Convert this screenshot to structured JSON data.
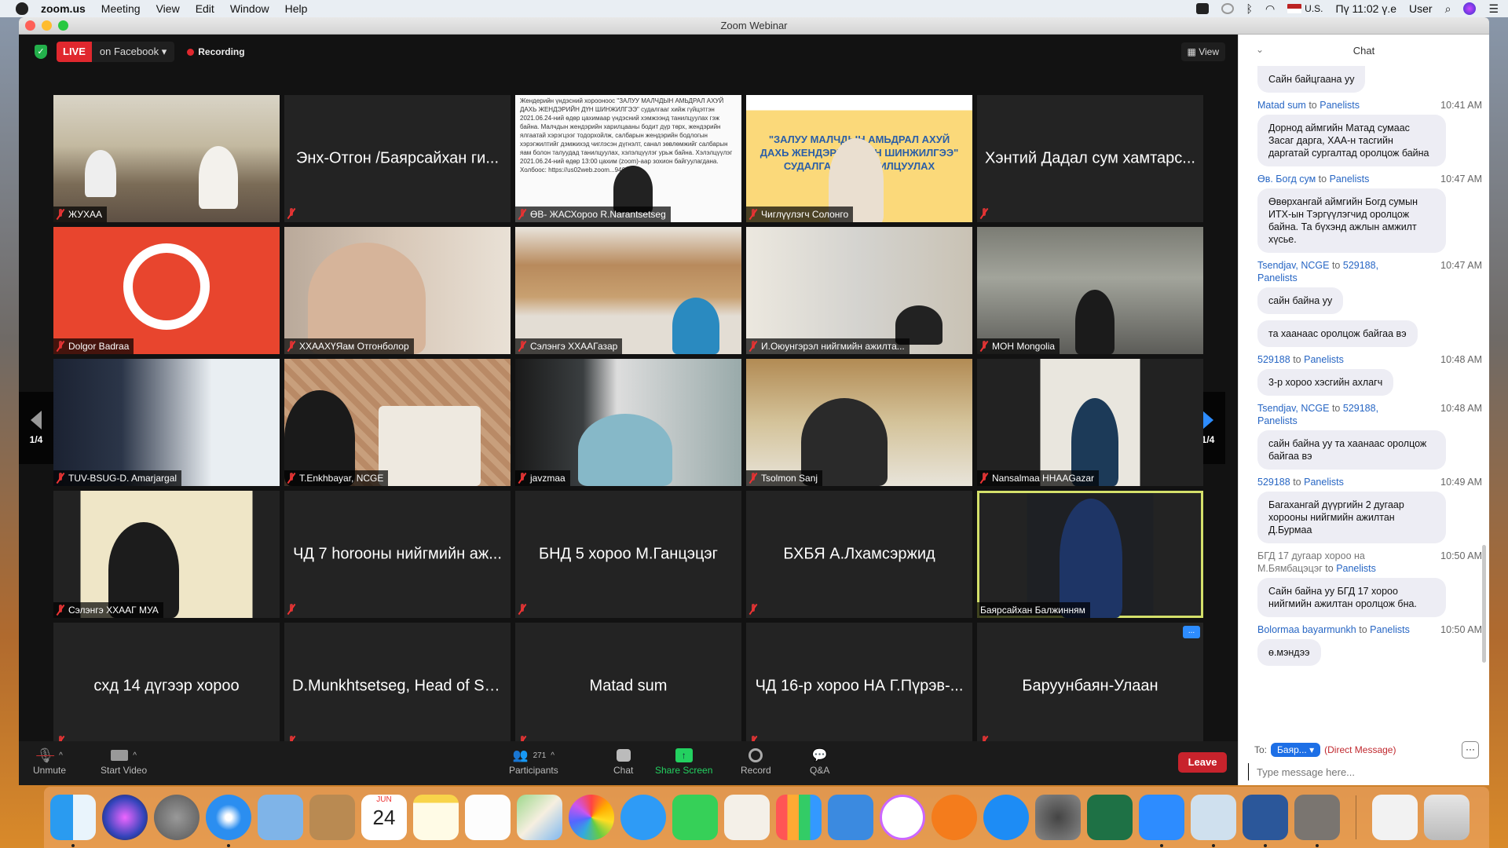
{
  "menubar": {
    "app": "zoom.us",
    "items": [
      "Meeting",
      "View",
      "Edit",
      "Window",
      "Help"
    ],
    "input_source": "U.S.",
    "clock": "Пү 11:02 ү.е",
    "user": "User"
  },
  "window": {
    "title": "Zoom Webinar"
  },
  "topbar": {
    "live_label": "LIVE",
    "live_target": "on Facebook",
    "recording_label": "Recording",
    "view_label": "View"
  },
  "pager": {
    "left_label": "1/4",
    "right_label": "1/4"
  },
  "tiles": [
    {
      "name": "ЖУХАА",
      "video": true,
      "muted": true
    },
    {
      "name": "Энх-Отгон /Баярсайхан ги...",
      "video": false,
      "muted": true
    },
    {
      "name": "ӨВ- ЖАСХороо R.Narantsetseg",
      "video": true,
      "muted": true,
      "shared_text": "Жендерийн үндэсний хорооноос \"ЗАЛУУ МАЛЧДЫН АМЬДРАЛ АХУЙ ДАХЬ ЖЕНДЭРИЙН ДҮН ШИНЖИЛГЭЭ\" судалгааг хийж гүйцэтгэн 2021.06.24-ний өдөр цахимаар үндэсний хэмжээнд танилцуулах гэж байна. Малчдын жендэрийн харилцааны бодит дүр төрх, жендэрийн ялгаатай хэрэгцээг тодорхойлж, салбарын жендэрийн бодлогын хэрэгжилтийг дэмжихэд чиглэсэн дүгнэлт, санал зөвлөмжийг салбарын яам болон талуудад танилцуулах, хэлэлцүүлэг урьж байна. Хэлэлцүүлэг 2021.06.24-ний өдөр 13:00 цахим (zoom)-аар зохион байгуулагдана. Холбоос: https://us02web.zoom...94662..."
    },
    {
      "name": "Чиглүүлэгч Солонго",
      "video": true,
      "muted": true,
      "shared_title": "\"ЗАЛУУ МАЛЧДЫН АМЬДРАЛ АХУЙ ДАХЬ ЖЕНДЭРИЙН ДҮН ШИНЖИЛГЭЭ\" СУДАЛГААНЫ ТАНИЛЦУУЛАХ"
    },
    {
      "name": "Хэнтий Дадал сум хамтарс...",
      "video": false,
      "muted": true
    },
    {
      "name": "Dolgor Badraa",
      "video": true,
      "muted": true
    },
    {
      "name": "ХХААХҮЯам Отгонболор",
      "video": true,
      "muted": true
    },
    {
      "name": "Сэлэнгэ ХХААГазар",
      "video": true,
      "muted": true
    },
    {
      "name": "И.Оюунгэрэл нийгмийн ажилта...",
      "video": true,
      "muted": true
    },
    {
      "name": "МОН Mongolia",
      "video": true,
      "muted": true
    },
    {
      "name": "TUV-BSUG-D. Amarjargal",
      "video": true,
      "muted": true
    },
    {
      "name": "T.Enkhbayar, NCGE",
      "video": true,
      "muted": true
    },
    {
      "name": "javzmaa",
      "video": true,
      "muted": true
    },
    {
      "name": "Tsolmon Sanj",
      "video": true,
      "muted": true
    },
    {
      "name": "Nansalmaa HHAAGazar",
      "video": true,
      "muted": true
    },
    {
      "name": "Сэлэнгэ ХХААГ МУА",
      "video": true,
      "muted": true
    },
    {
      "name": "ЧД 7 horooны нийгмийн аж...",
      "video": false,
      "muted": true
    },
    {
      "name": "БНД 5 хороо М.Ганцэцэг",
      "video": false,
      "muted": true
    },
    {
      "name": "БХБЯ А.Лхамсэржид",
      "video": false,
      "muted": true
    },
    {
      "name": "Баярсайхан Балжинням",
      "video": true,
      "muted": false,
      "active_speaker": true
    },
    {
      "name": "схд 14 дүгээр хороо",
      "video": false,
      "muted": true
    },
    {
      "name": "D.Munkhtsetseg, Head of So...",
      "video": false,
      "muted": true
    },
    {
      "name": "Matad sum",
      "video": false,
      "muted": true
    },
    {
      "name": "ЧД 16-р хороо НА Г.Пүрэв-...",
      "video": false,
      "muted": true
    },
    {
      "name": "Баруунбаян-Улаан",
      "video": false,
      "muted": true,
      "more_icon": "..."
    }
  ],
  "toolbar": {
    "unmute": "Unmute",
    "start_video": "Start Video",
    "participants": "Participants",
    "participant_count": "271",
    "chat": "Chat",
    "share_screen": "Share Screen",
    "record": "Record",
    "qa": "Q&A",
    "leave": "Leave"
  },
  "chat": {
    "title": "Chat",
    "messages": [
      {
        "sender": "",
        "to": "",
        "time": "",
        "text": "Сайн байцгаана уу"
      },
      {
        "sender": "Matad sum",
        "to": "Panelists",
        "time": "10:41 AM",
        "text": "Дорнод аймгийн Матад сумаас Засаг дарга, ХАА-н тасгийн даргатай сургалтад оролцож байна"
      },
      {
        "sender": "Өв. Богд сум",
        "to": "Panelists",
        "time": "10:47 AM",
        "text": "Өвөрхангай аймгийн Богд сумын ИТХ-ын Тэргүүлэгчид оролцож байна. Та бүхэнд ажлын амжилт хүсье."
      },
      {
        "sender": "Tsendjav, NCGE",
        "to": "529188, Panelists",
        "time": "10:47 AM",
        "text": "сайн байна уу"
      },
      {
        "sender": "",
        "to": "",
        "time": "",
        "text": "та хаанаас оролцож байгаа вэ"
      },
      {
        "sender": "529188",
        "to": "Panelists",
        "time": "10:48 AM",
        "text": "3-р хороо хэсгийн ахлагч"
      },
      {
        "sender": "Tsendjav, NCGE",
        "to": "529188, Panelists",
        "time": "10:48 AM",
        "text": "сайн байна уу та хаанаас оролцож байгаа вэ"
      },
      {
        "sender": "529188",
        "to": "Panelists",
        "time": "10:49 AM",
        "text": "Багахангай дүүргийн 2 дугаар хорооны нийгмийн ажилтан Д.Бурмаа"
      },
      {
        "sender": "БГД 17 дугаар хороо на М.Бямбацэцэг",
        "to": "Panelists",
        "time": "10:50 AM",
        "text": "Сайн байна уу БГД 17 хороо нийгмийн ажилтан оролцож бна.",
        "sender_gray": true
      },
      {
        "sender": "Bolormaa bayarmunkh",
        "to": "Panelists",
        "time": "10:50 AM",
        "text": "ө.мэндээ"
      }
    ],
    "to_prefix": "To:",
    "to_word": "to",
    "recipient": "Баяр...",
    "direct_message": "(Direct Message)",
    "more": "···",
    "input_placeholder": "Type message here..."
  },
  "dock": {
    "calendar_month": "JUN",
    "calendar_day": "24",
    "apps": [
      "Finder",
      "Siri",
      "Launchpad",
      "Safari",
      "Mail",
      "Contacts",
      "Calendar",
      "Notes",
      "Reminders",
      "Maps",
      "Photos",
      "Messages",
      "FaceTime",
      "Pages",
      "Numbers",
      "Keynote",
      "iTunes",
      "Books",
      "App Store",
      "System Preferences",
      "Excel",
      "Zoom",
      "Preview",
      "Word",
      "Calculator",
      "Downloads",
      "Trash"
    ]
  },
  "colors": {
    "accent": "#2d8cff",
    "live": "#e0282e",
    "leave": "#c8232c",
    "share_green": "#23d160",
    "active_speaker": "#d4e06a"
  }
}
